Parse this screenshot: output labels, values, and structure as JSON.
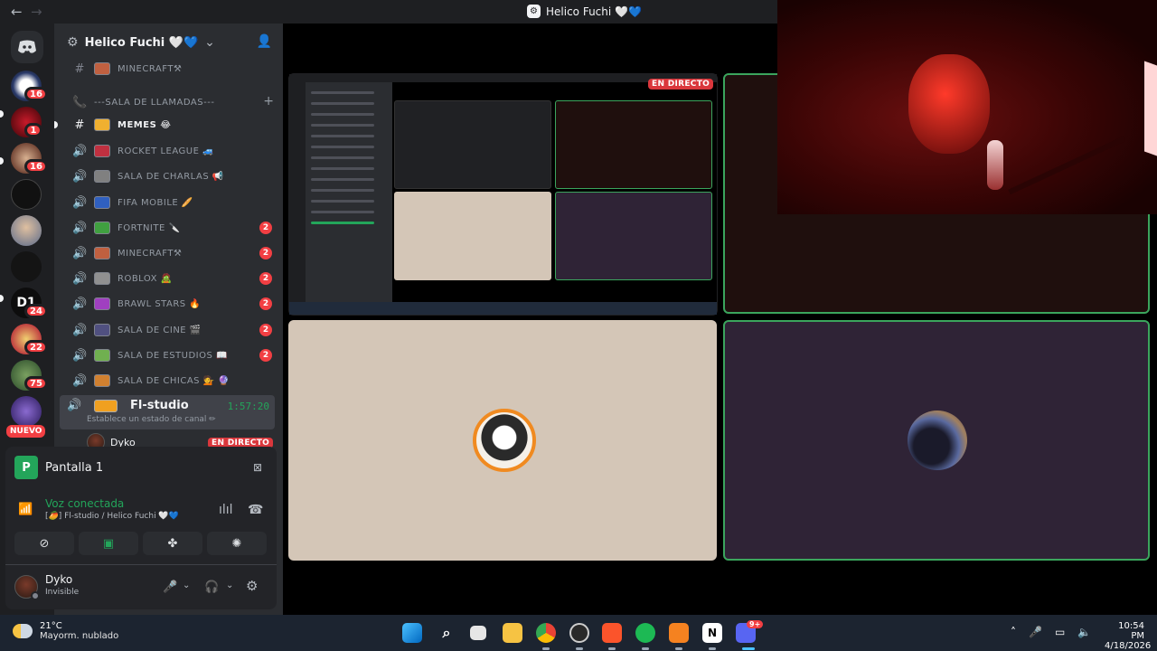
{
  "window": {
    "title": "Helico Fuchi 🤍💙",
    "back_label": "←",
    "forward_label": "→"
  },
  "server_rail": {
    "badges": [
      "16",
      "1",
      "16",
      "24",
      "22",
      "75"
    ],
    "new_label": "NUEVO"
  },
  "sidebar": {
    "server_name": "Helico Fuchi 🤍💙",
    "category": "---SALA DE LLAMADAS---",
    "channels": [
      {
        "name": "MINECRAFT⚒",
        "count": ""
      },
      {
        "name": "MEMES 😂",
        "count": ""
      },
      {
        "name": "ROCKET LEAGUE 🚙",
        "count": ""
      },
      {
        "name": "SALA DE CHARLAS 📢",
        "count": ""
      },
      {
        "name": "FIFA MOBILE 🥖",
        "count": ""
      },
      {
        "name": "FORTNITE 🔪",
        "count": "2"
      },
      {
        "name": "MINECRAFT⚒",
        "count": "2"
      },
      {
        "name": "ROBLOX 🧟",
        "count": "2"
      },
      {
        "name": "BRAWL STARS 🔥",
        "count": "2"
      },
      {
        "name": "SALA DE CINE 🎬",
        "count": "2"
      },
      {
        "name": "SALA DE ESTUDIOS 📖",
        "count": "2"
      },
      {
        "name": "SALA DE CHICAS 💁 🔮",
        "count": ""
      }
    ],
    "active_channel": {
      "name": "Fl-studio",
      "elapsed": "1:57:20",
      "status_placeholder": "Establece un estado de canal ✏"
    },
    "voice_user": {
      "name": "Dyko",
      "live_label": "EN DIRECTO"
    }
  },
  "panel": {
    "stream_name": "Pantalla 1",
    "voice_status": "Voz conectada",
    "voice_location": "[🥭] Fl-studio / Helico Fuchi 🤍💙",
    "user_name": "Dyko",
    "user_status": "Invisible"
  },
  "stage": {
    "live_label": "EN DIRECTO"
  },
  "taskbar": {
    "temperature": "21°C",
    "weather": "Mayorm. nublado",
    "time": "10:54 PM",
    "date": "4/18/2026",
    "discord_badge": "9+",
    "apps": [
      "start-icon",
      "search-icon",
      "task-view-icon",
      "file-explorer-icon",
      "chrome-icon",
      "obs-icon",
      "brave-icon",
      "spotify-icon",
      "fl-studio-icon",
      "notion-icon",
      "discord-icon"
    ]
  },
  "colors": {
    "accent_green": "#23a55a",
    "live_red": "#da373c",
    "badge_red": "#f23f43",
    "sidebar_bg": "#2b2d31",
    "rail_bg": "#1e1f22"
  }
}
